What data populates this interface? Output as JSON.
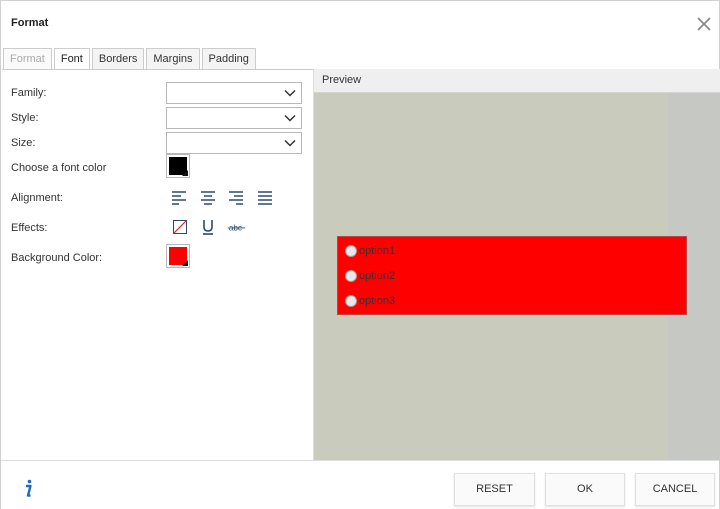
{
  "dialog": {
    "title": "Format"
  },
  "tabs": [
    {
      "label": "Format",
      "state": "disabled"
    },
    {
      "label": "Font",
      "state": "active"
    },
    {
      "label": "Borders",
      "state": "normal"
    },
    {
      "label": "Margins",
      "state": "normal"
    },
    {
      "label": "Padding",
      "state": "normal"
    }
  ],
  "font_panel": {
    "family_label": "Family:",
    "family_value": "",
    "style_label": "Style:",
    "style_value": "",
    "size_label": "Size:",
    "size_value": "",
    "font_color_label": "Choose a font color",
    "font_color": "#000000",
    "alignment_label": "Alignment:",
    "alignment_icons": [
      "align-left-icon",
      "align-center-icon",
      "align-right-icon",
      "align-justify-icon"
    ],
    "effects_label": "Effects:",
    "effects_icons": [
      "no-effect-icon",
      "underline-icon",
      "strikethrough-icon"
    ],
    "strikethrough_sample": "abc",
    "background_color_label": "Background Color:",
    "background_color": "#ff0000"
  },
  "preview": {
    "header": "Preview",
    "options": [
      "option1",
      "option2",
      "option3"
    ],
    "box_color": "#ff0000"
  },
  "footer": {
    "info_icon": "info-icon",
    "reset_label": "RESET",
    "ok_label": "OK",
    "cancel_label": "CANCEL"
  },
  "colors": {
    "preview_background": "#c9cbbd",
    "icon_dark": "#2b4a6a",
    "info_blue": "#1e6bb8"
  }
}
